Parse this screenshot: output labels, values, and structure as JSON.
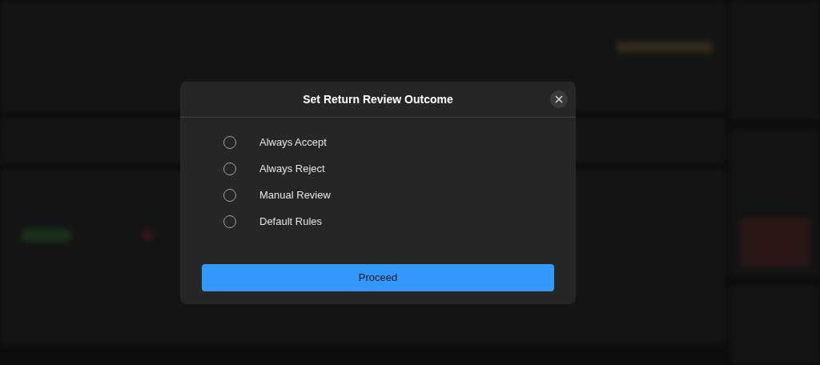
{
  "dialog": {
    "title": "Set Return Review Outcome",
    "options": [
      {
        "label": "Always Accept",
        "selected": false
      },
      {
        "label": "Always Reject",
        "selected": false
      },
      {
        "label": "Manual Review",
        "selected": false
      },
      {
        "label": "Default Rules",
        "selected": false
      }
    ],
    "primary_button": "Proceed"
  }
}
